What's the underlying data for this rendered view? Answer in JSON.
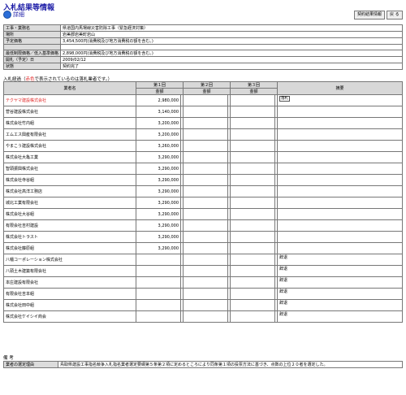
{
  "page": {
    "title": "入札結果等情報",
    "detail_label": "詳細",
    "btn_contract": "契約結果情報",
    "btn_back": "戻 る"
  },
  "info": [
    {
      "key": "工事・業務名",
      "value": "県道国内馬場線災害防除工事（緊急経済対策）"
    },
    {
      "key": "場所",
      "value": "岩美郡岩美町岩山"
    },
    {
      "key": "予定価格",
      "value": "3,454,500円(消費税及び地方消費税の額を含む。)"
    },
    {
      "key": "",
      "value": ""
    },
    {
      "key": "最低制限価格／低入基準価格",
      "value": "2,898,000円(消費税及び地方消費税の額を含む。)"
    },
    {
      "key": "開札（予定）日",
      "value": "2009/02/12"
    },
    {
      "key": "状態",
      "value": "契約完了"
    }
  ],
  "bids_section": {
    "label_prefix": "入札経過（",
    "label_red": "赤色",
    "label_suffix": "で表示されているのは落札業者です。）"
  },
  "bids_headers": {
    "name": "業者名",
    "round1": "第１回",
    "round2": "第２回",
    "round3": "第３回",
    "amount": "金額",
    "remarks": "摘要"
  },
  "bids": [
    {
      "name": "テクヤマ建設株式会社",
      "amount": "2,980,000",
      "remark": "落札",
      "winner": true
    },
    {
      "name": "菅谷建設株式会社",
      "amount": "3,140,000",
      "remark": ""
    },
    {
      "name": "株式会社竹内組",
      "amount": "3,200,000",
      "remark": ""
    },
    {
      "name": "エムエス興産有限会社",
      "amount": "3,200,000",
      "remark": ""
    },
    {
      "name": "やまこう建設株式会社",
      "amount": "3,260,000",
      "remark": ""
    },
    {
      "name": "株式会社大亀工業",
      "amount": "3,290,000",
      "remark": ""
    },
    {
      "name": "智頭振興株式会社",
      "amount": "3,290,000",
      "remark": ""
    },
    {
      "name": "株式会社寺谷組",
      "amount": "3,290,000",
      "remark": ""
    },
    {
      "name": "株式会社高洋工務店",
      "amount": "3,290,000",
      "remark": ""
    },
    {
      "name": "城北工業有限会社",
      "amount": "3,290,000",
      "remark": ""
    },
    {
      "name": "株式会社大谷組",
      "amount": "3,290,000",
      "remark": ""
    },
    {
      "name": "有限会社吉村建設",
      "amount": "3,290,000",
      "remark": ""
    },
    {
      "name": "株式会社トラスト",
      "amount": "3,290,000",
      "remark": ""
    },
    {
      "name": "株式会社藤原組",
      "amount": "3,290,000",
      "remark": ""
    },
    {
      "name": "八幡コーポレーション株式会社",
      "amount": "",
      "remark": "辞退"
    },
    {
      "name": "八頭土木建築有限会社",
      "amount": "",
      "remark": "辞退"
    },
    {
      "name": "本庄建設有限会社",
      "amount": "",
      "remark": "辞退"
    },
    {
      "name": "有限会社吉本組",
      "amount": "",
      "remark": "辞退"
    },
    {
      "name": "株式会社田中組",
      "amount": "",
      "remark": "辞退"
    },
    {
      "name": "株式会社ケイシイ商会",
      "amount": "",
      "remark": "辞退"
    }
  ],
  "notes": {
    "title": "備 考",
    "key": "業者の選定理由",
    "value": "鳥取県建設工事指名競争入札指名業者選定要綱第５条第２項に定めるところにより同条第１項の投票方法に基づき、点数の上位２０者を選定した。"
  }
}
